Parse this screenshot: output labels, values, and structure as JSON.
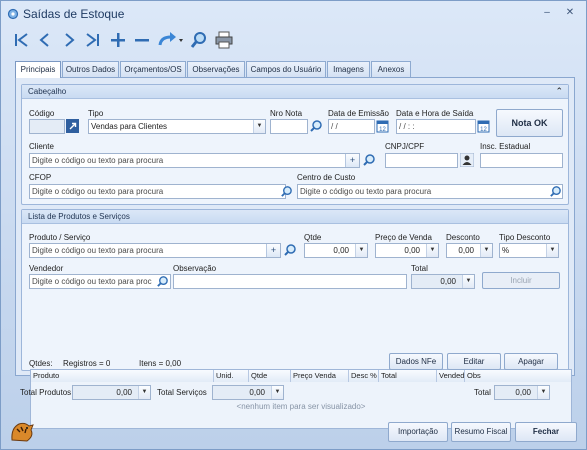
{
  "window": {
    "title": "Saídas de Estoque",
    "minimize": "–",
    "close": "✕"
  },
  "tabs": [
    "Principais",
    "Outros Dados",
    "Orçamentos/OS",
    "Observações",
    "Campos do Usuário",
    "Imagens",
    "Anexos"
  ],
  "cabecalho": {
    "title": "Cabeçalho",
    "codigo_label": "Código",
    "tipo_label": "Tipo",
    "tipo_value": "Vendas para Clientes",
    "nro_nota_label": "Nro Nota",
    "data_emissao_label": "Data de Emissão",
    "data_emissao_value": " / /",
    "data_saida_label": "Data e Hora de Saída",
    "data_saida_value": " / /     :  :",
    "nota_ok": "Nota OK",
    "cliente_label": "Cliente",
    "cliente_placeholder": "Digite o código ou texto para procura",
    "cnpj_label": "CNPJ/CPF",
    "insc_label": "Insc. Estadual",
    "cfop_label": "CFOP",
    "cfop_placeholder": "Digite o código ou texto para procura",
    "centro_label": "Centro de Custo",
    "centro_placeholder": "Digite o código ou texto para procura"
  },
  "lista": {
    "title": "Lista de Produtos e Serviços",
    "produto_label": "Produto / Serviço",
    "produto_placeholder": "Digite o código ou texto para procura",
    "qtde_label": "Qtde",
    "qtde_value": "0,00",
    "preco_label": "Preço de Venda",
    "preco_value": "0,00",
    "desconto_label": "Desconto",
    "desconto_value": "0,00",
    "tipo_desc_label": "Tipo Desconto",
    "tipo_desc_value": "%",
    "vendedor_label": "Vendedor",
    "vendedor_placeholder": "Digite o código ou texto para proc",
    "obs_label": "Observação",
    "total_label": "Total",
    "total_value": "0,00",
    "incluir": "Incluir",
    "columns": [
      "Produto",
      "Unid.",
      "Qtde",
      "Preço Venda",
      "Desc %",
      "Total",
      "Vended",
      "Obs"
    ],
    "empty": "<nenhum item para ser visualizado>",
    "qtdes_label": "Qtdes:",
    "registros": "Registros = 0",
    "itens": "Itens = 0,00",
    "dados_nfe": "Dados NFe",
    "editar": "Editar",
    "apagar": "Apagar"
  },
  "totals": {
    "produtos_label": "Total Produtos",
    "produtos_value": "0,00",
    "servicos_label": "Total Serviços",
    "servicos_value": "0,00",
    "total_label": "Total",
    "total_value": "0,00"
  },
  "footer": {
    "importacao": "Importação",
    "resumo": "Resumo Fiscal",
    "fechar": "Fechar"
  },
  "colors": {
    "accent": "#2b5fa8",
    "frame": "#c9d9ef"
  }
}
